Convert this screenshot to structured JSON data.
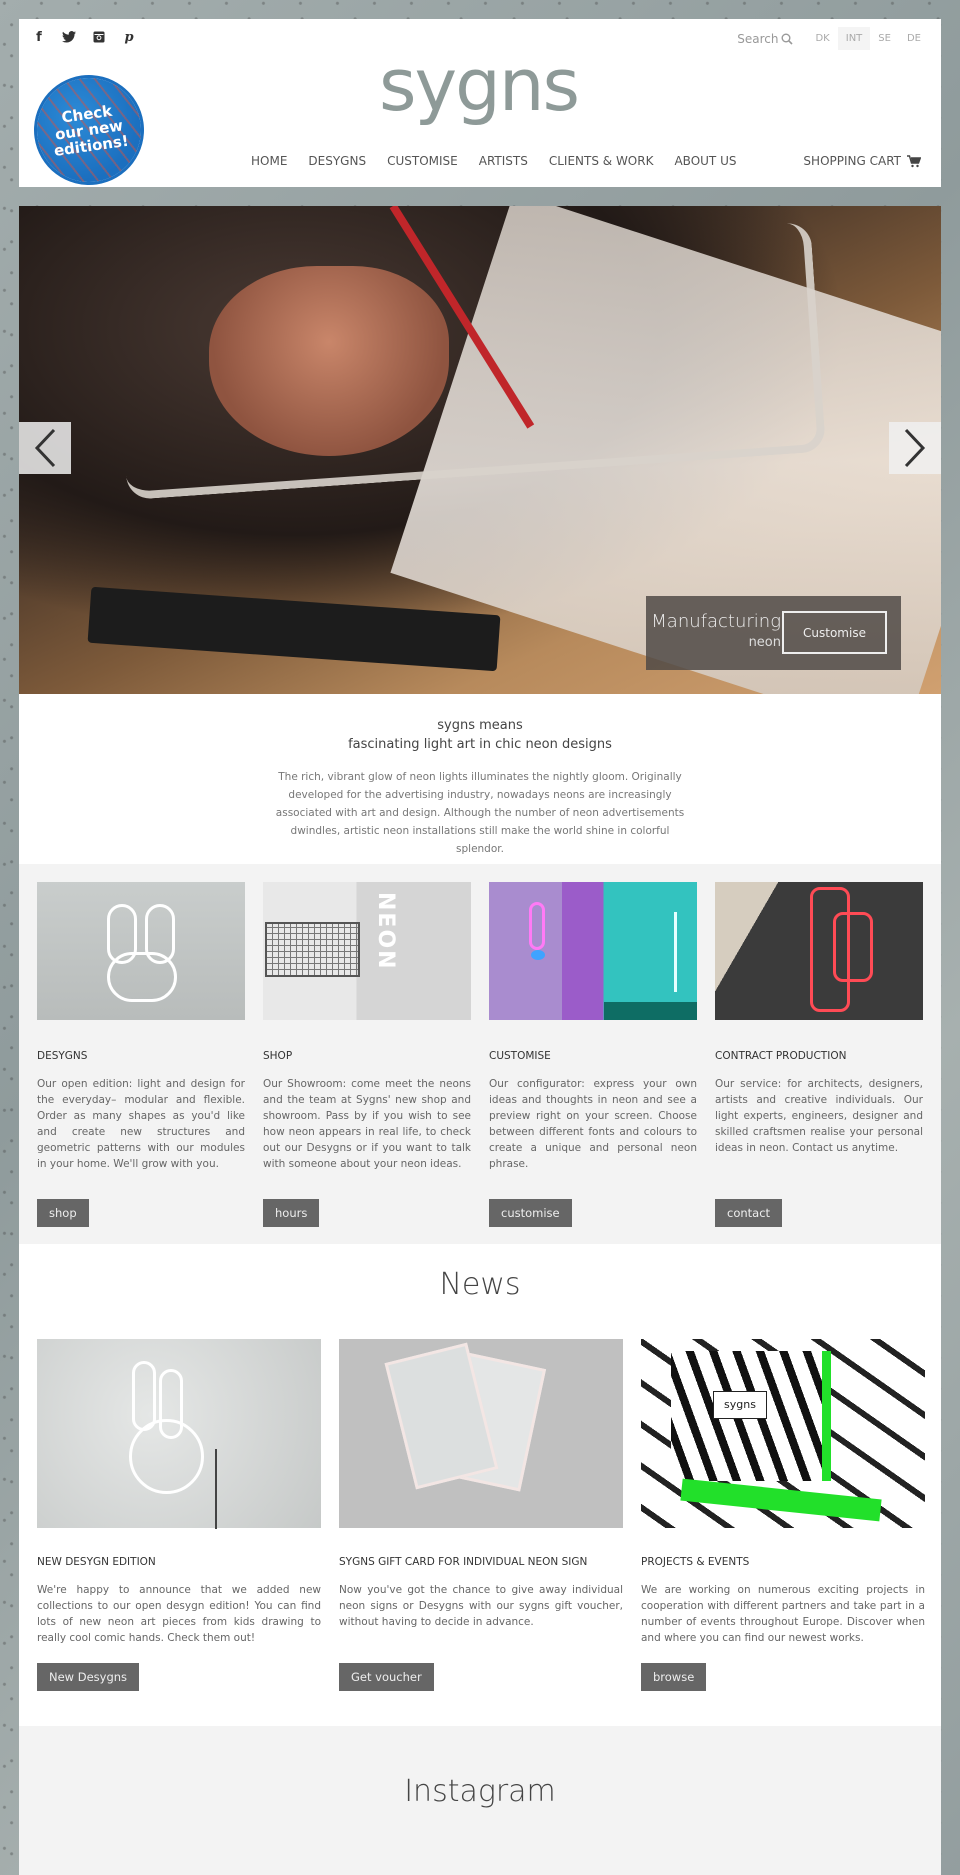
{
  "header": {
    "social": [
      {
        "name": "facebook-icon",
        "glyph": "f"
      },
      {
        "name": "twitter-icon",
        "glyph": "🐦"
      },
      {
        "name": "instagram-icon",
        "glyph": "◙"
      },
      {
        "name": "pinterest-icon",
        "glyph": "𝓅"
      }
    ],
    "search_label": "Search",
    "languages": [
      "DK",
      "INT",
      "SE",
      "DE"
    ],
    "active_language": "INT",
    "logo": "sygns",
    "badge_text": "Check our new editions!",
    "nav": [
      "HOME",
      "DESYGNS",
      "CUSTOMISE",
      "ARTISTS",
      "CLIENTS & WORK",
      "ABOUT US"
    ],
    "cart_label": "SHOPPING CART"
  },
  "hero": {
    "caption_title": "Manufacturing",
    "caption_subtitle": "neon",
    "caption_button": "Customise"
  },
  "intro": {
    "heading_line1": "sygns means",
    "heading_line2": "fascinating light art in chic neon designs",
    "body": "The rich, vibrant glow of neon lights illuminates the nightly gloom. Originally developed for the advertising industry, nowadays neons are increasingly associated with art and design. Although the number of neon advertisements dwindles, artistic neon installations still make the world shine in colorful splendor."
  },
  "features": [
    {
      "title": "DESYGNS",
      "text": "Our open edition: light and design for the everyday– modular and flexible. Order as many shapes as you'd like and create new structures and geometric patterns with our modules in your home. We'll grow with you.",
      "button": "shop"
    },
    {
      "title": "SHOP",
      "text": "Our Showroom: come meet the neons and the team at Sygns' new shop and showroom. Pass by if you wish to see how neon appears in real life, to check out our Desygns or if you want to talk with someone about your neon ideas.",
      "button": "hours"
    },
    {
      "title": "CUSTOMISE",
      "text": "Our configurator: express your own ideas and thoughts in neon and see a preview right on your screen. Choose between different fonts and colours to create a unique and personal neon phrase.",
      "button": "customise"
    },
    {
      "title": "CONTRACT PRODUCTION",
      "text": "Our service: for architects, designers, artists and creative individuals. Our light experts, engineers, designer and skilled craftsmen realise your personal ideas in neon. Contact us anytime.",
      "button": "contact"
    }
  ],
  "news": {
    "heading": "News",
    "items": [
      {
        "title": "NEW DESYGN EDITION",
        "text": "We're happy to announce that we added new collections to our open desygn edition! You can find lots of new neon art pieces from kids drawing to really cool comic hands. Check them out!",
        "button": "New Desygns"
      },
      {
        "title": "SYGNS GIFT CARD FOR INDIVIDUAL NEON SIGN",
        "text": "Now you've got the chance to give away individual neon signs or Desygns with our sygns gift voucher, without having to decide in advance.",
        "button": "Get voucher"
      },
      {
        "title": "PROJECTS & EVENTS",
        "text": "We are working on numerous exciting projects in cooperation with different partners and take part in a number of events throughout Europe. Discover when and where you can find our newest works.",
        "button": "browse"
      }
    ]
  },
  "instagram": {
    "heading": "Instagram"
  },
  "colors": {
    "button_bg": "#666666",
    "section_gray": "#f3f3f3",
    "badge_blue": "#1b6fbf"
  }
}
